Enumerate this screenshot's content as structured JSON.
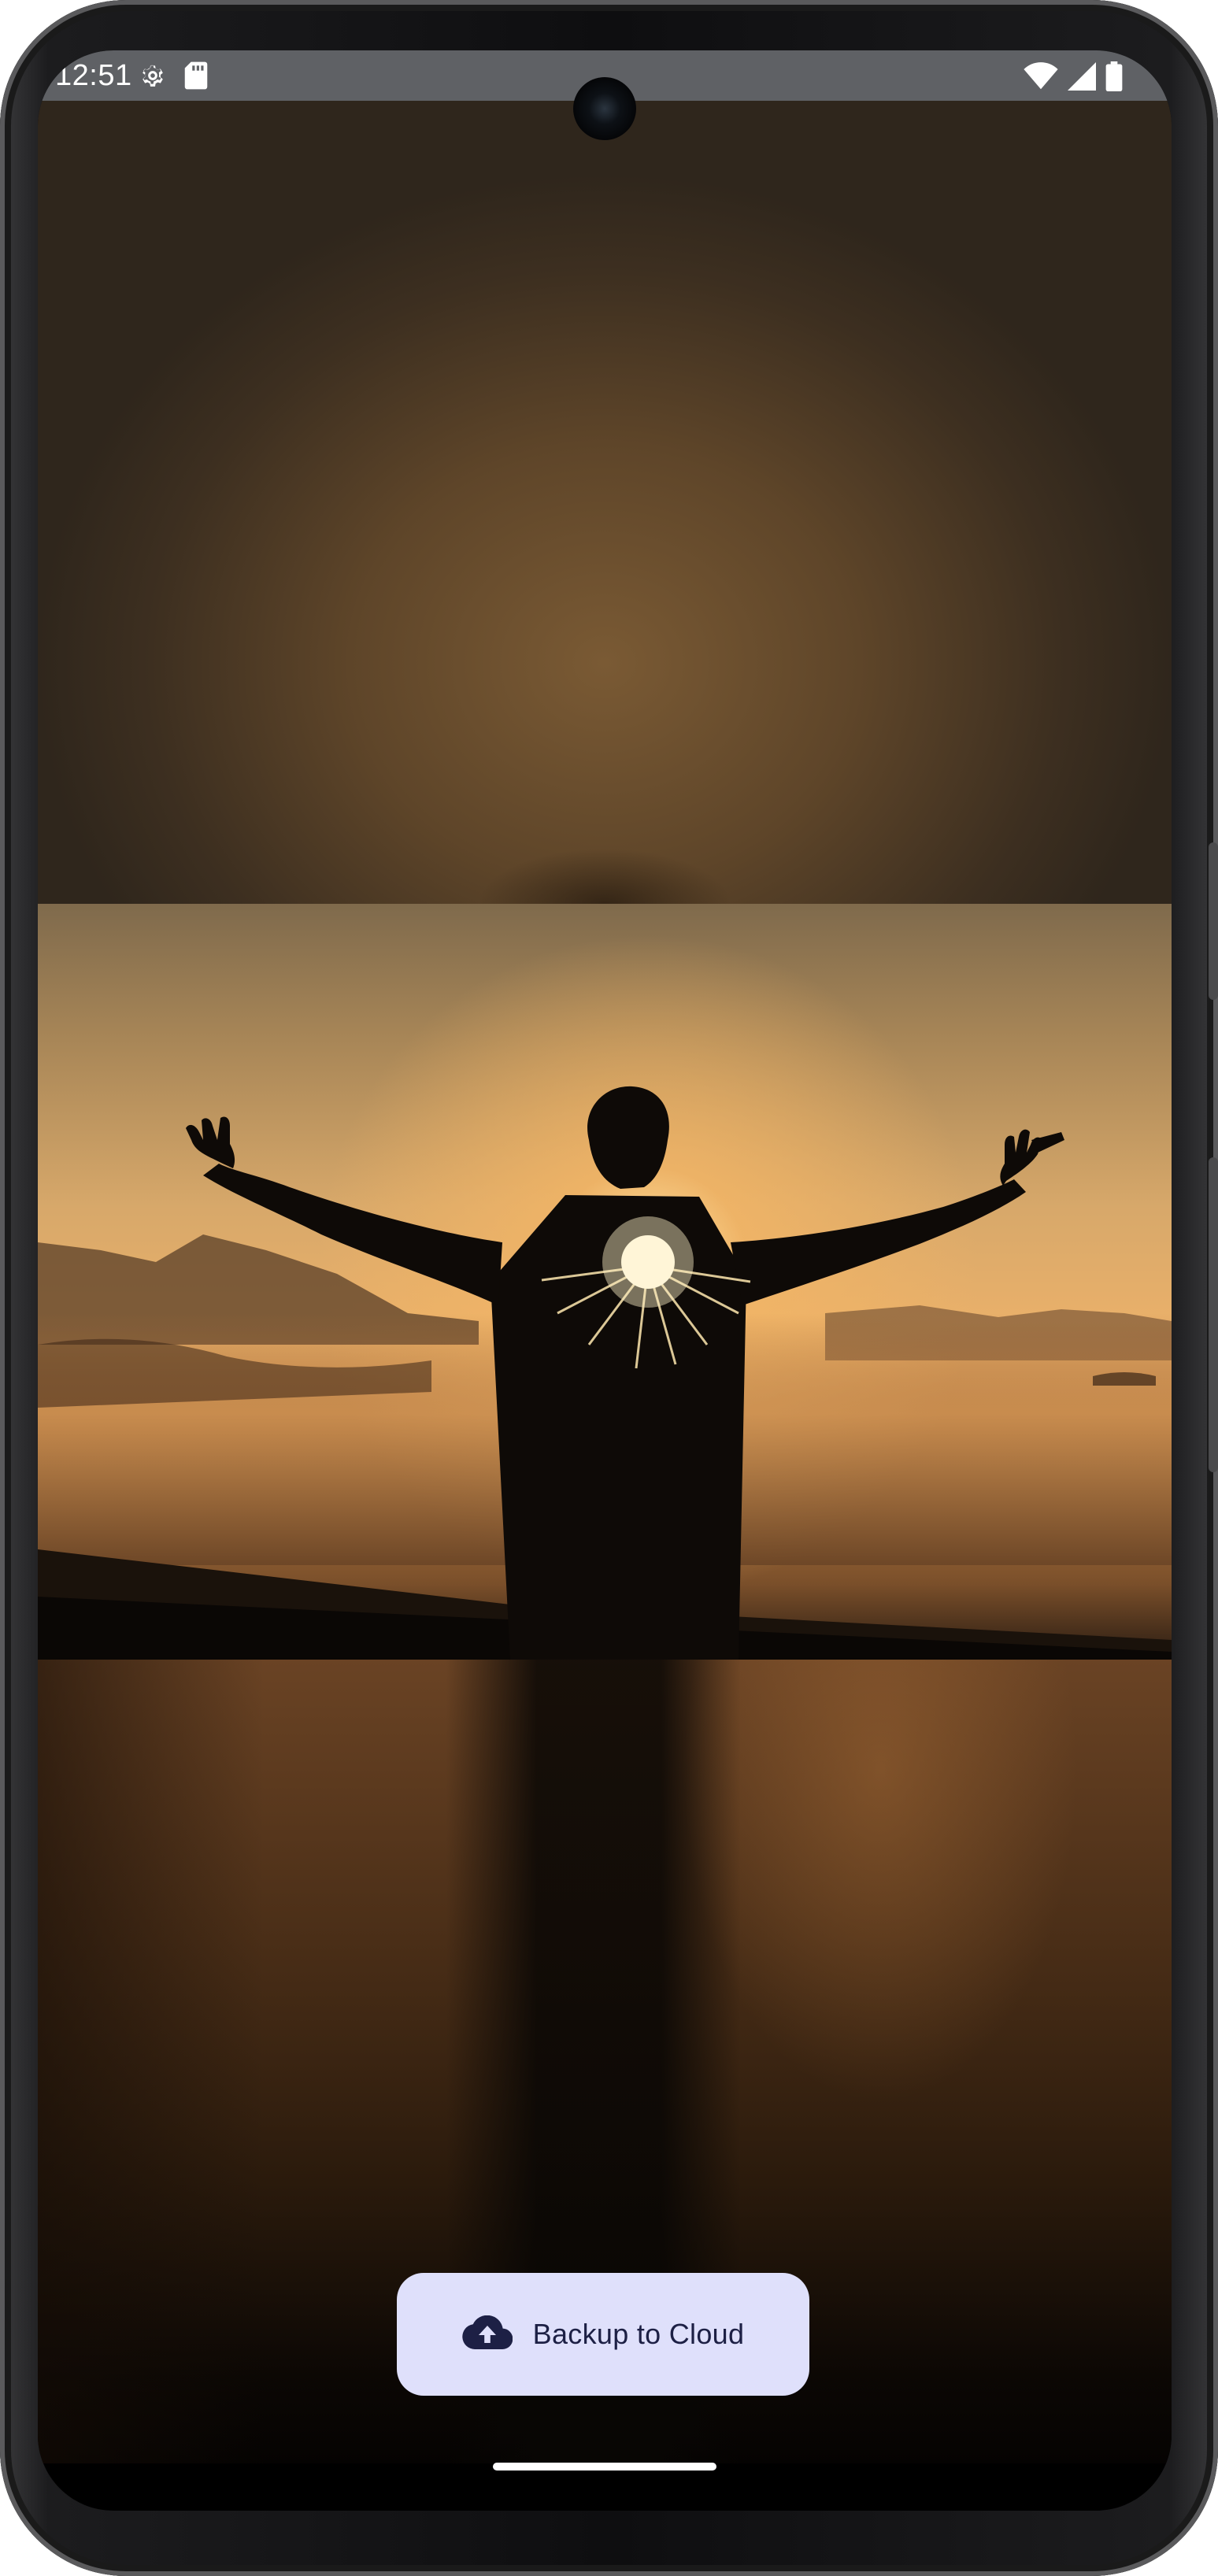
{
  "status_bar": {
    "time": "12:51",
    "left_icons": [
      "settings-gear-icon",
      "sd-card-icon"
    ],
    "right_icons": [
      "wifi-icon",
      "cellular-signal-icon",
      "battery-icon"
    ]
  },
  "content": {
    "image_subject": "silhouette-arms-outstretched-sunrise"
  },
  "action_button": {
    "label": "Backup to Cloud",
    "icon": "cloud-upload-icon",
    "background": "#dfe0fb",
    "text_color": "#1d2045"
  },
  "colors": {
    "status_bar_bg": "#5f6165"
  }
}
